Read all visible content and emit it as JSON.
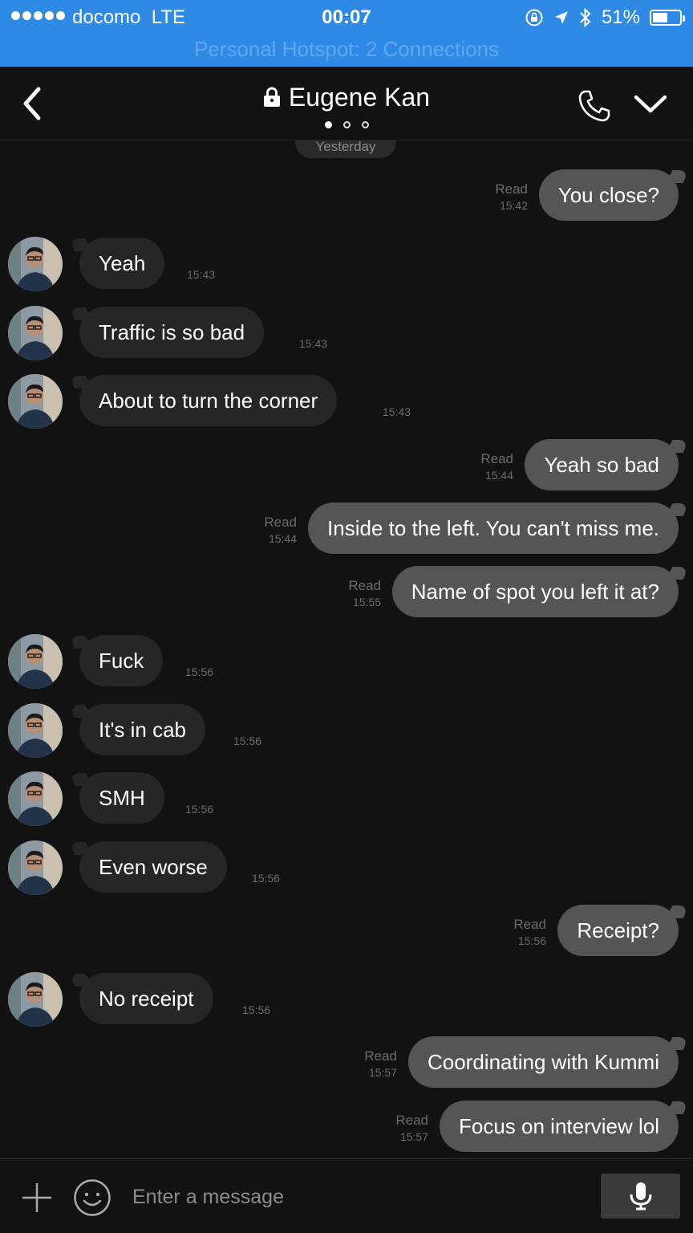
{
  "status_bar": {
    "carrier": "docomo",
    "network": "LTE",
    "time": "00:07",
    "battery": "51%",
    "battery_level": 0.51,
    "hotspot": "Personal Hotspot: 2 Connections"
  },
  "header": {
    "title": "Eugene Kan",
    "page_dots": 3,
    "active_dot": 0
  },
  "day_separator": "Yesterday",
  "messages": [
    {
      "dir": "out",
      "text": "You close?",
      "read": "Read",
      "time": "15:42"
    },
    {
      "dir": "in",
      "text": "Yeah",
      "time": "15:43"
    },
    {
      "dir": "in",
      "text": "Traffic is so bad",
      "time": "15:43"
    },
    {
      "dir": "in",
      "text": "About to turn the corner",
      "time": "15:43"
    },
    {
      "dir": "out",
      "text": "Yeah so bad",
      "read": "Read",
      "time": "15:44"
    },
    {
      "dir": "out",
      "text": "Inside to the left. You can't miss me.",
      "read": "Read",
      "time": "15:44"
    },
    {
      "dir": "out",
      "text": "Name of spot you left it at?",
      "read": "Read",
      "time": "15:55"
    },
    {
      "dir": "in",
      "text": "Fuck",
      "time": "15:56"
    },
    {
      "dir": "in",
      "text": "It's in cab",
      "time": "15:56"
    },
    {
      "dir": "in",
      "text": "SMH",
      "time": "15:56"
    },
    {
      "dir": "in",
      "text": "Even worse",
      "time": "15:56"
    },
    {
      "dir": "out",
      "text": "Receipt?",
      "read": "Read",
      "time": "15:56"
    },
    {
      "dir": "in",
      "text": "No receipt",
      "time": "15:56"
    },
    {
      "dir": "out",
      "text": "Coordinating with Kummi",
      "read": "Read",
      "time": "15:57"
    },
    {
      "dir": "out",
      "text": "Focus on interview lol",
      "read": "Read",
      "time": "15:57"
    }
  ],
  "input": {
    "placeholder": "Enter a message",
    "value": ""
  },
  "icons": {
    "back": "chevron-left-icon",
    "lock": "lock-icon",
    "call": "phone-icon",
    "menu": "chevron-down-icon",
    "attach": "plus-icon",
    "emoji": "smiley-icon",
    "voice": "microphone-icon"
  },
  "colors": {
    "status_bar": "#2f8ae6",
    "background": "#121212",
    "incoming_bubble": "#262626",
    "outgoing_bubble": "#555555"
  }
}
